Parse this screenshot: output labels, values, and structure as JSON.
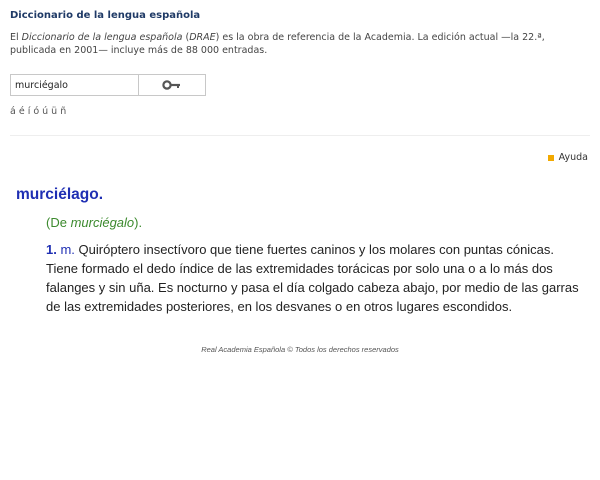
{
  "header": {
    "title": "Diccionario de la lengua española"
  },
  "intro": {
    "part1": "El ",
    "book_title": "Diccionario de la lengua española",
    "part2": " (",
    "abbr": "DRAE",
    "part3": ") es la obra de referencia de la Academia. La edición actual —la 22.ª, publicada en 2001— incluye más de 88 000 entradas."
  },
  "search": {
    "value": "murciégalo",
    "button_icon": "search-key-icon"
  },
  "accents": [
    "á",
    "é",
    "í",
    "ó",
    "ú",
    "ü",
    "ñ"
  ],
  "help": {
    "label": "Ayuda",
    "bullet_color": "#f2a900"
  },
  "entry": {
    "lemma": "murciélago",
    "lemma_dot": ".",
    "etym_open": "(De ",
    "etym_word": "murciégalo",
    "etym_close": ").",
    "sense_number": "1.",
    "sense_abbr": "m.",
    "definition": "Quiróptero insectívoro que tiene fuertes caninos y los molares con puntas cónicas. Tiene formado el dedo índice de las extremidades torácicas por solo una o a lo más dos falanges y sin uña. Es nocturno y pasa el día colgado cabeza abajo, por medio de las garras de las extremidades posteriores, en los desvanes o en otros lugares escondidos."
  },
  "footer": {
    "copyright": "Real Academia Española © Todos los derechos reservados"
  }
}
